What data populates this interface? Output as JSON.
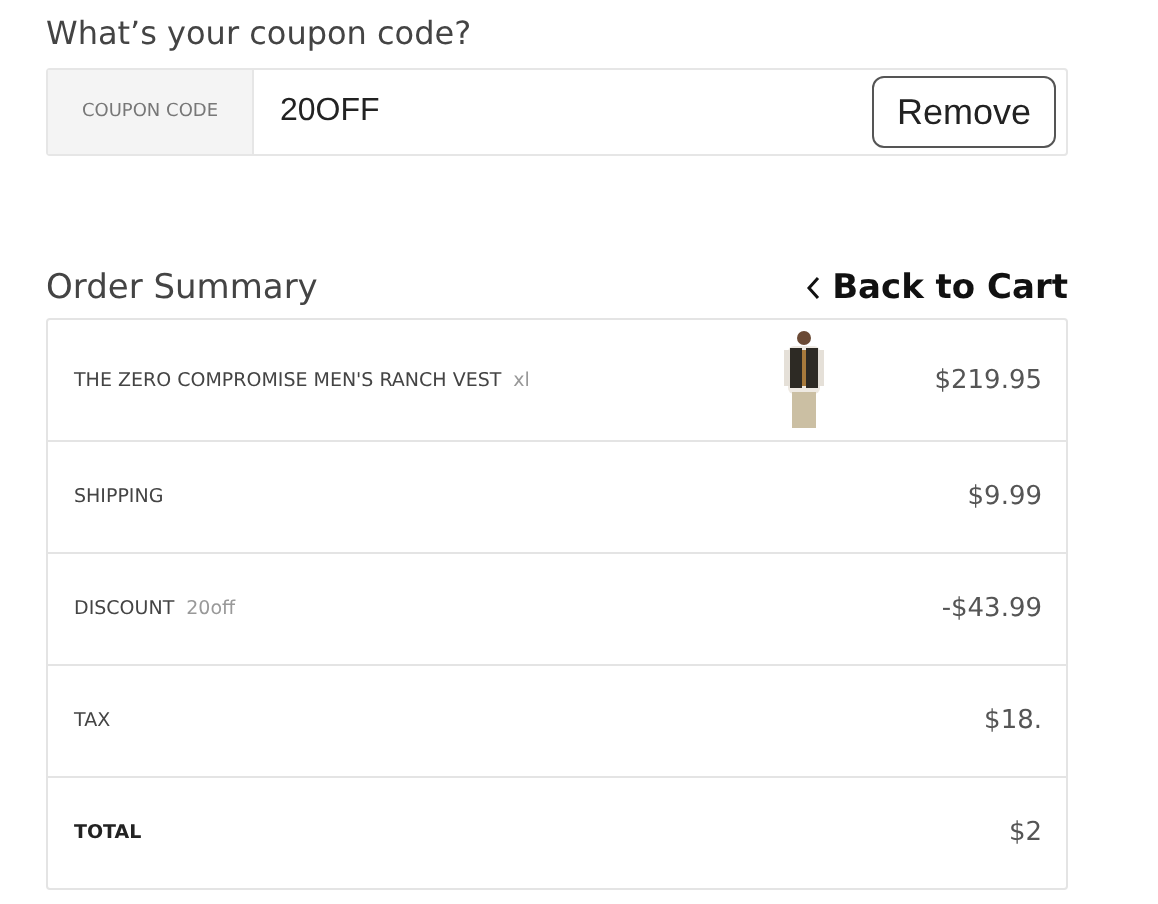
{
  "coupon": {
    "heading": "What’s your coupon code?",
    "label": "COUPON CODE",
    "value": "20OFF",
    "button": "Remove"
  },
  "summary": {
    "title": "Order Summary",
    "back_link": "Back to Cart",
    "rows": [
      {
        "kind": "product",
        "label": "THE ZERO COMPROMISE MEN'S RANCH VEST",
        "note": "xl",
        "amount": "$219.95"
      },
      {
        "kind": "line",
        "label": "SHIPPING",
        "amount": "$9.99"
      },
      {
        "kind": "line",
        "label": "DISCOUNT",
        "note": "20off",
        "amount": "-$43.99"
      },
      {
        "kind": "line",
        "label": "TAX",
        "amount": "$18."
      },
      {
        "kind": "total",
        "label": "TOTAL",
        "amount": "$2"
      }
    ]
  }
}
